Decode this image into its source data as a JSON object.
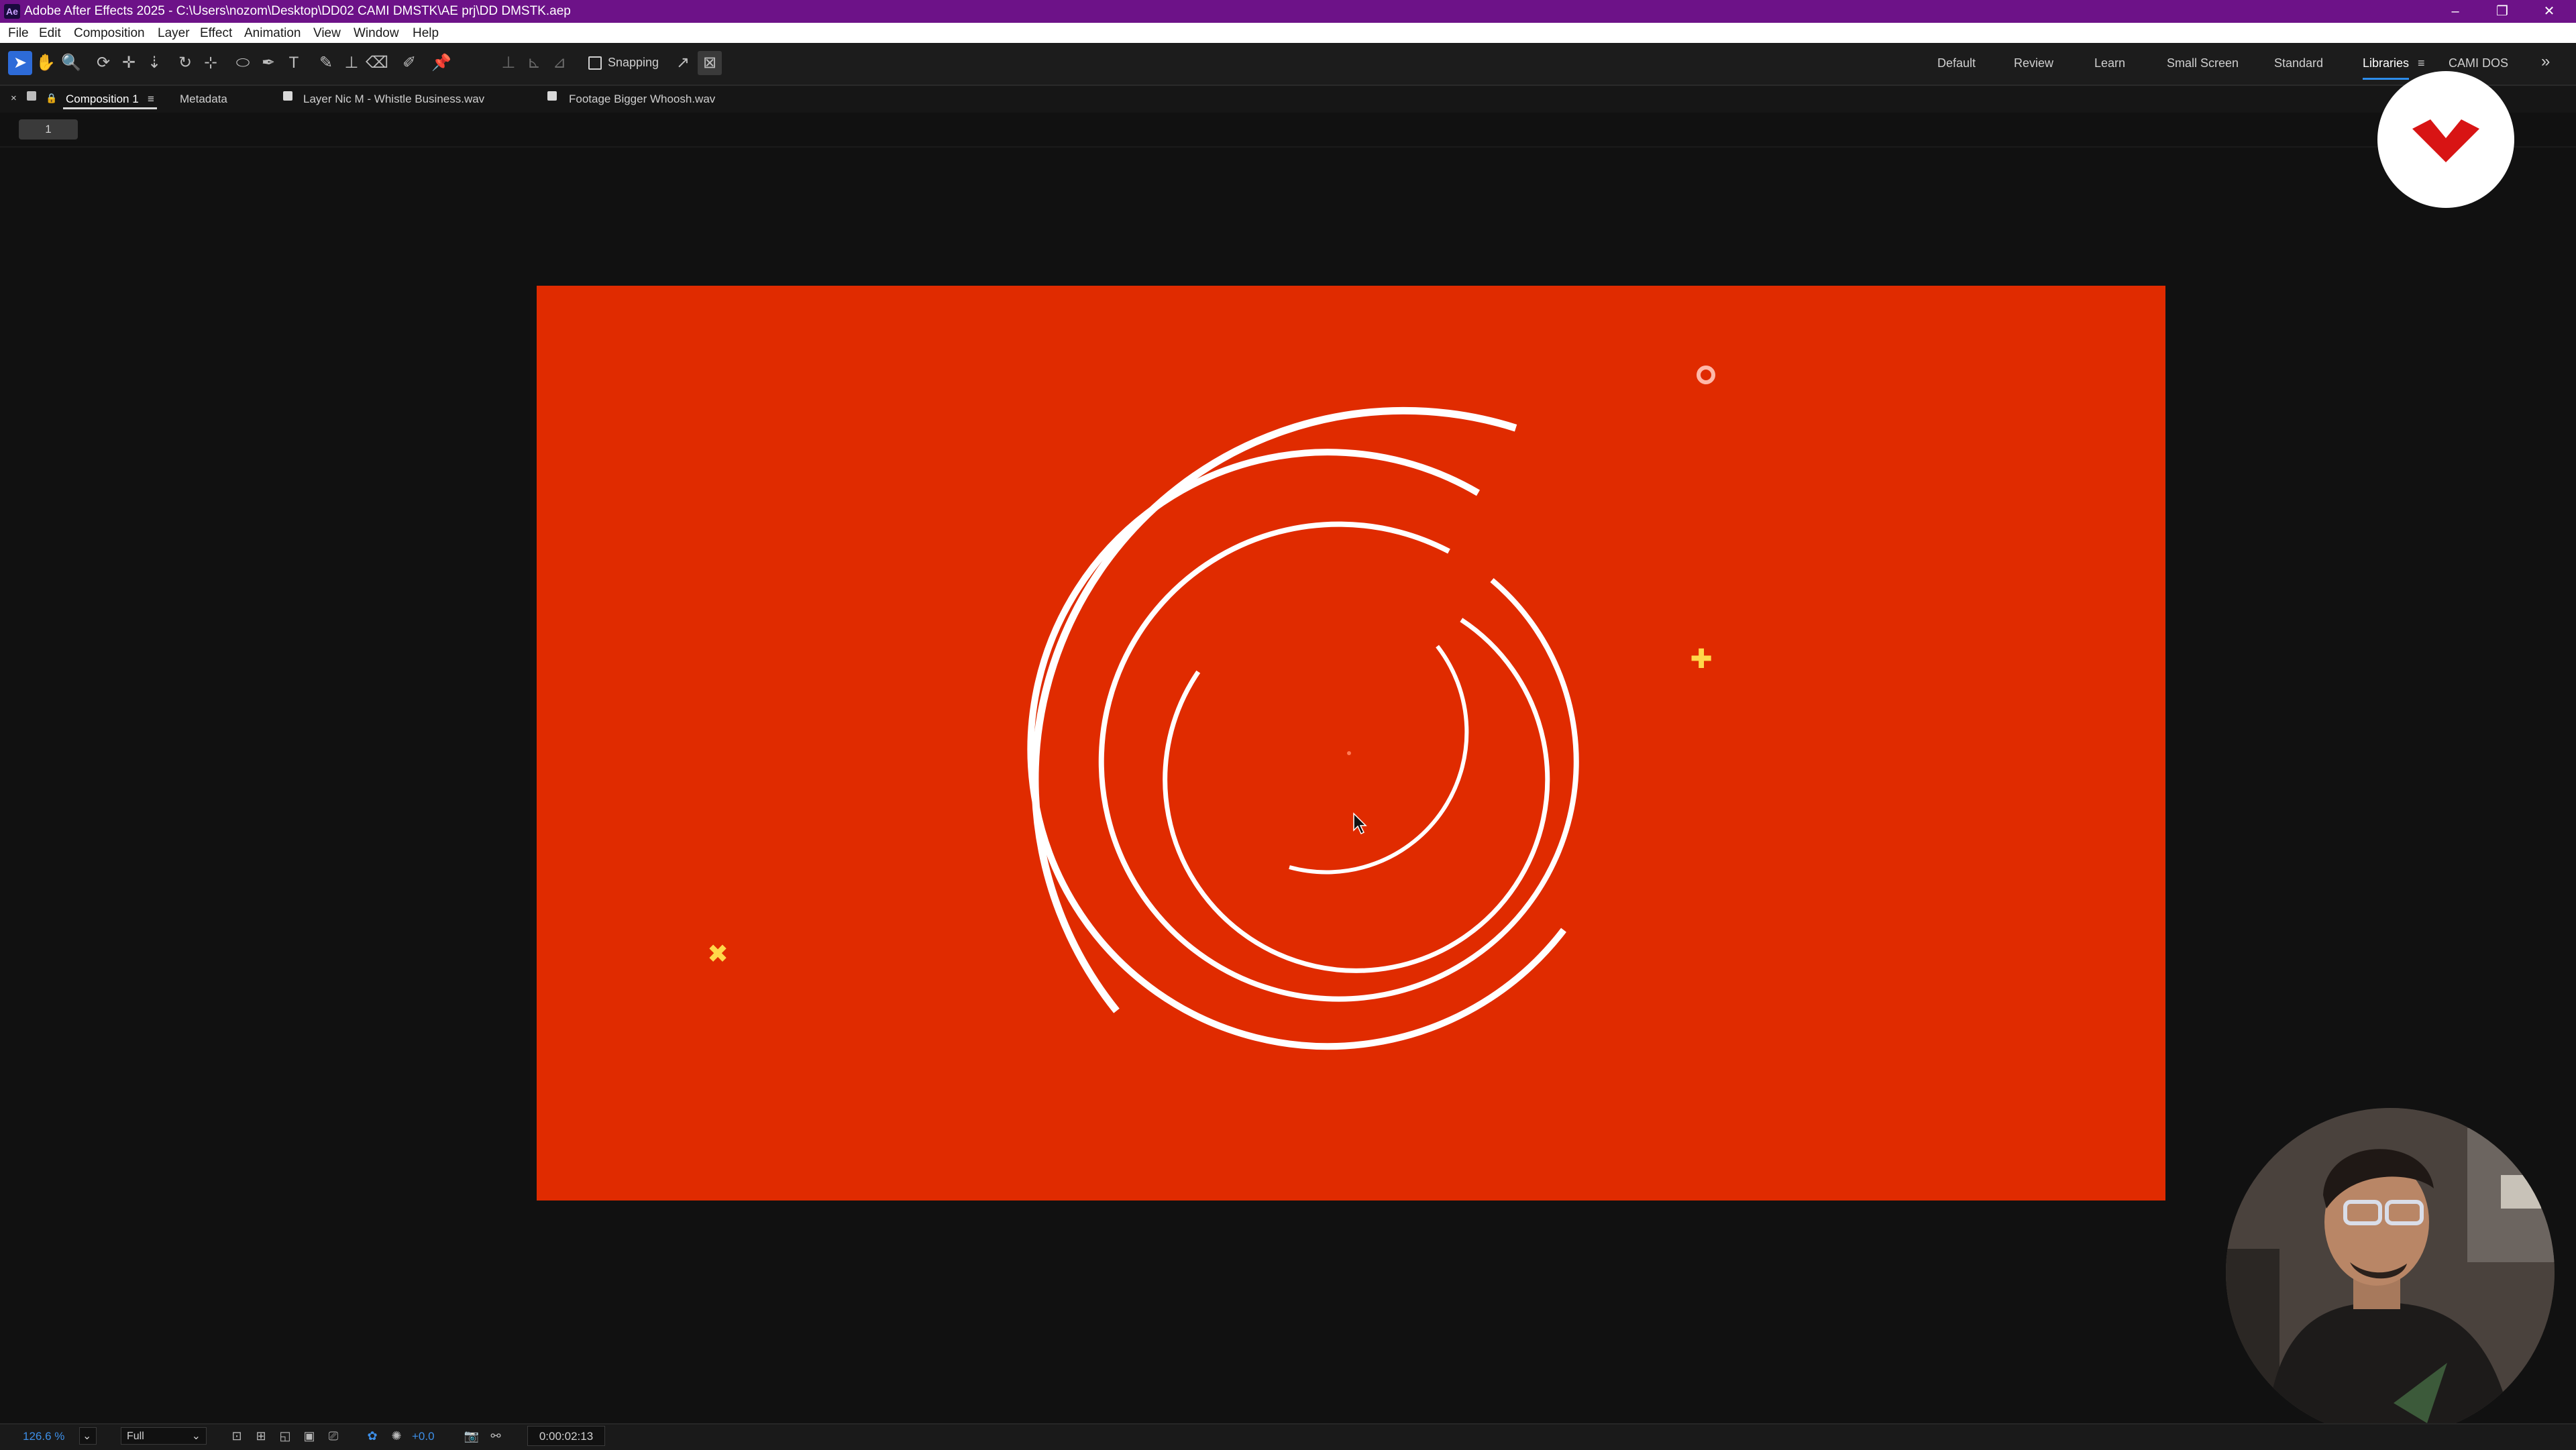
{
  "titlebar": {
    "app_icon": "Ae",
    "title": "Adobe After Effects 2025 - C:\\Users\\nozom\\Desktop\\DD02 CAMI DMSTK\\AE prj\\DD DMSTK.aep",
    "minimize": "–",
    "restore": "❐",
    "close": "✕"
  },
  "menu": [
    "File",
    "Edit",
    "Composition",
    "Layer",
    "Effect",
    "Animation",
    "View",
    "Window",
    "Help"
  ],
  "toolbar": {
    "tools": [
      {
        "name": "selection-tool-icon",
        "glyph": "➤"
      },
      {
        "name": "hand-tool-icon",
        "glyph": "✋"
      },
      {
        "name": "zoom-tool-icon",
        "glyph": "🔍"
      },
      {
        "name": "orbit-camera-tool-icon",
        "glyph": "⟳"
      },
      {
        "name": "pan-camera-tool-icon",
        "glyph": "✛"
      },
      {
        "name": "dolly-camera-tool-icon",
        "glyph": "⇣"
      },
      {
        "name": "rotation-tool-icon",
        "glyph": "↻"
      },
      {
        "name": "pan-behind-tool-icon",
        "glyph": "⊹"
      },
      {
        "name": "ellipse-tool-icon",
        "glyph": "⬭"
      },
      {
        "name": "pen-tool-icon",
        "glyph": "✒"
      },
      {
        "name": "type-tool-icon",
        "glyph": "T"
      },
      {
        "name": "brush-tool-icon",
        "glyph": "✎"
      },
      {
        "name": "clone-stamp-tool-icon",
        "glyph": "⊥"
      },
      {
        "name": "eraser-tool-icon",
        "glyph": "⌫"
      },
      {
        "name": "roto-brush-tool-icon",
        "glyph": "✐"
      },
      {
        "name": "puppet-pin-tool-icon",
        "glyph": "📌"
      }
    ],
    "snapping_label": "Snapping",
    "workspaces": [
      "Default",
      "Review",
      "Learn",
      "Small Screen",
      "Standard",
      "Libraries",
      "CAMI DOS"
    ],
    "active_workspace": "Libraries",
    "overflow_glyph": "»",
    "workspace_menu_glyph": "≡"
  },
  "panel_tabs": {
    "close_glyph": "×",
    "lock_glyph": "🔒",
    "menu_glyph": "≡",
    "composition": "Composition 1",
    "metadata": "Metadata",
    "layer": "Layer Nic M - Whistle Business.wav",
    "footage": "Footage Bigger Whoosh.wav"
  },
  "viewer_chip": "1",
  "comp": {
    "background": "#e02b00",
    "stroke_color": "#ffffff",
    "accent_color": "#ffd84a"
  },
  "statusbar": {
    "zoom": "126.6 %",
    "resolution": "Full",
    "exposure": "+0.0",
    "timecode": "0:00:02:13"
  }
}
